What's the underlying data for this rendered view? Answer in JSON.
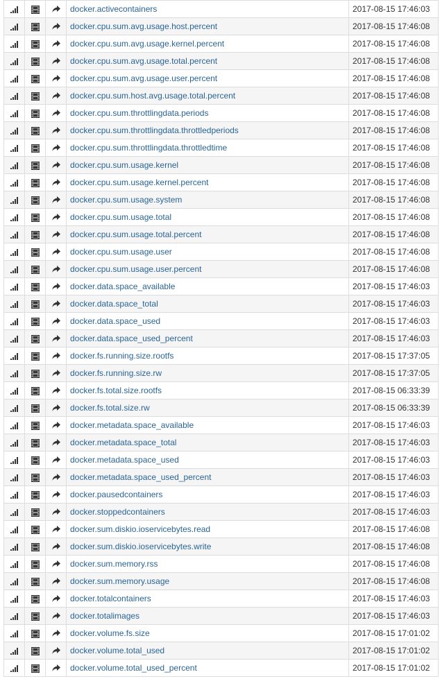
{
  "metrics": [
    {
      "name": "docker.activecontainers",
      "timestamp": "2017-08-15 17:46:03"
    },
    {
      "name": "docker.cpu.sum.avg.usage.host.percent",
      "timestamp": "2017-08-15 17:46:08"
    },
    {
      "name": "docker.cpu.sum.avg.usage.kernel.percent",
      "timestamp": "2017-08-15 17:46:08"
    },
    {
      "name": "docker.cpu.sum.avg.usage.total.percent",
      "timestamp": "2017-08-15 17:46:08"
    },
    {
      "name": "docker.cpu.sum.avg.usage.user.percent",
      "timestamp": "2017-08-15 17:46:08"
    },
    {
      "name": "docker.cpu.sum.host.avg.usage.total.percent",
      "timestamp": "2017-08-15 17:46:08"
    },
    {
      "name": "docker.cpu.sum.throttlingdata.periods",
      "timestamp": "2017-08-15 17:46:08"
    },
    {
      "name": "docker.cpu.sum.throttlingdata.throttledperiods",
      "timestamp": "2017-08-15 17:46:08"
    },
    {
      "name": "docker.cpu.sum.throttlingdata.throttledtime",
      "timestamp": "2017-08-15 17:46:08"
    },
    {
      "name": "docker.cpu.sum.usage.kernel",
      "timestamp": "2017-08-15 17:46:08"
    },
    {
      "name": "docker.cpu.sum.usage.kernel.percent",
      "timestamp": "2017-08-15 17:46:08"
    },
    {
      "name": "docker.cpu.sum.usage.system",
      "timestamp": "2017-08-15 17:46:08"
    },
    {
      "name": "docker.cpu.sum.usage.total",
      "timestamp": "2017-08-15 17:46:08"
    },
    {
      "name": "docker.cpu.sum.usage.total.percent",
      "timestamp": "2017-08-15 17:46:08"
    },
    {
      "name": "docker.cpu.sum.usage.user",
      "timestamp": "2017-08-15 17:46:08"
    },
    {
      "name": "docker.cpu.sum.usage.user.percent",
      "timestamp": "2017-08-15 17:46:08"
    },
    {
      "name": "docker.data.space_available",
      "timestamp": "2017-08-15 17:46:03"
    },
    {
      "name": "docker.data.space_total",
      "timestamp": "2017-08-15 17:46:03"
    },
    {
      "name": "docker.data.space_used",
      "timestamp": "2017-08-15 17:46:03"
    },
    {
      "name": "docker.data.space_used_percent",
      "timestamp": "2017-08-15 17:46:03"
    },
    {
      "name": "docker.fs.running.size.rootfs",
      "timestamp": "2017-08-15 17:37:05"
    },
    {
      "name": "docker.fs.running.size.rw",
      "timestamp": "2017-08-15 17:37:05"
    },
    {
      "name": "docker.fs.total.size.rootfs",
      "timestamp": "2017-08-15 06:33:39"
    },
    {
      "name": "docker.fs.total.size.rw",
      "timestamp": "2017-08-15 06:33:39"
    },
    {
      "name": "docker.metadata.space_available",
      "timestamp": "2017-08-15 17:46:03"
    },
    {
      "name": "docker.metadata.space_total",
      "timestamp": "2017-08-15 17:46:03"
    },
    {
      "name": "docker.metadata.space_used",
      "timestamp": "2017-08-15 17:46:03"
    },
    {
      "name": "docker.metadata.space_used_percent",
      "timestamp": "2017-08-15 17:46:03"
    },
    {
      "name": "docker.pausedcontainers",
      "timestamp": "2017-08-15 17:46:03"
    },
    {
      "name": "docker.stoppedcontainers",
      "timestamp": "2017-08-15 17:46:03"
    },
    {
      "name": "docker.sum.diskio.ioservicebytes.read",
      "timestamp": "2017-08-15 17:46:08"
    },
    {
      "name": "docker.sum.diskio.ioservicebytes.write",
      "timestamp": "2017-08-15 17:46:08"
    },
    {
      "name": "docker.sum.memory.rss",
      "timestamp": "2017-08-15 17:46:08"
    },
    {
      "name": "docker.sum.memory.usage",
      "timestamp": "2017-08-15 17:46:08"
    },
    {
      "name": "docker.totalcontainers",
      "timestamp": "2017-08-15 17:46:03"
    },
    {
      "name": "docker.totalimages",
      "timestamp": "2017-08-15 17:46:03"
    },
    {
      "name": "docker.volume.fs.size",
      "timestamp": "2017-08-15 17:01:02"
    },
    {
      "name": "docker.volume.total_used",
      "timestamp": "2017-08-15 17:01:02"
    },
    {
      "name": "docker.volume.total_used_percent",
      "timestamp": "2017-08-15 17:01:02"
    }
  ],
  "icons": {
    "chart": "signal-bars-icon",
    "film": "film-icon",
    "share": "share-arrow-icon"
  },
  "colors": {
    "link": "#2a6496",
    "border": "#dddddd",
    "row_alt": "#f5f5f5",
    "icon": "#333333"
  }
}
